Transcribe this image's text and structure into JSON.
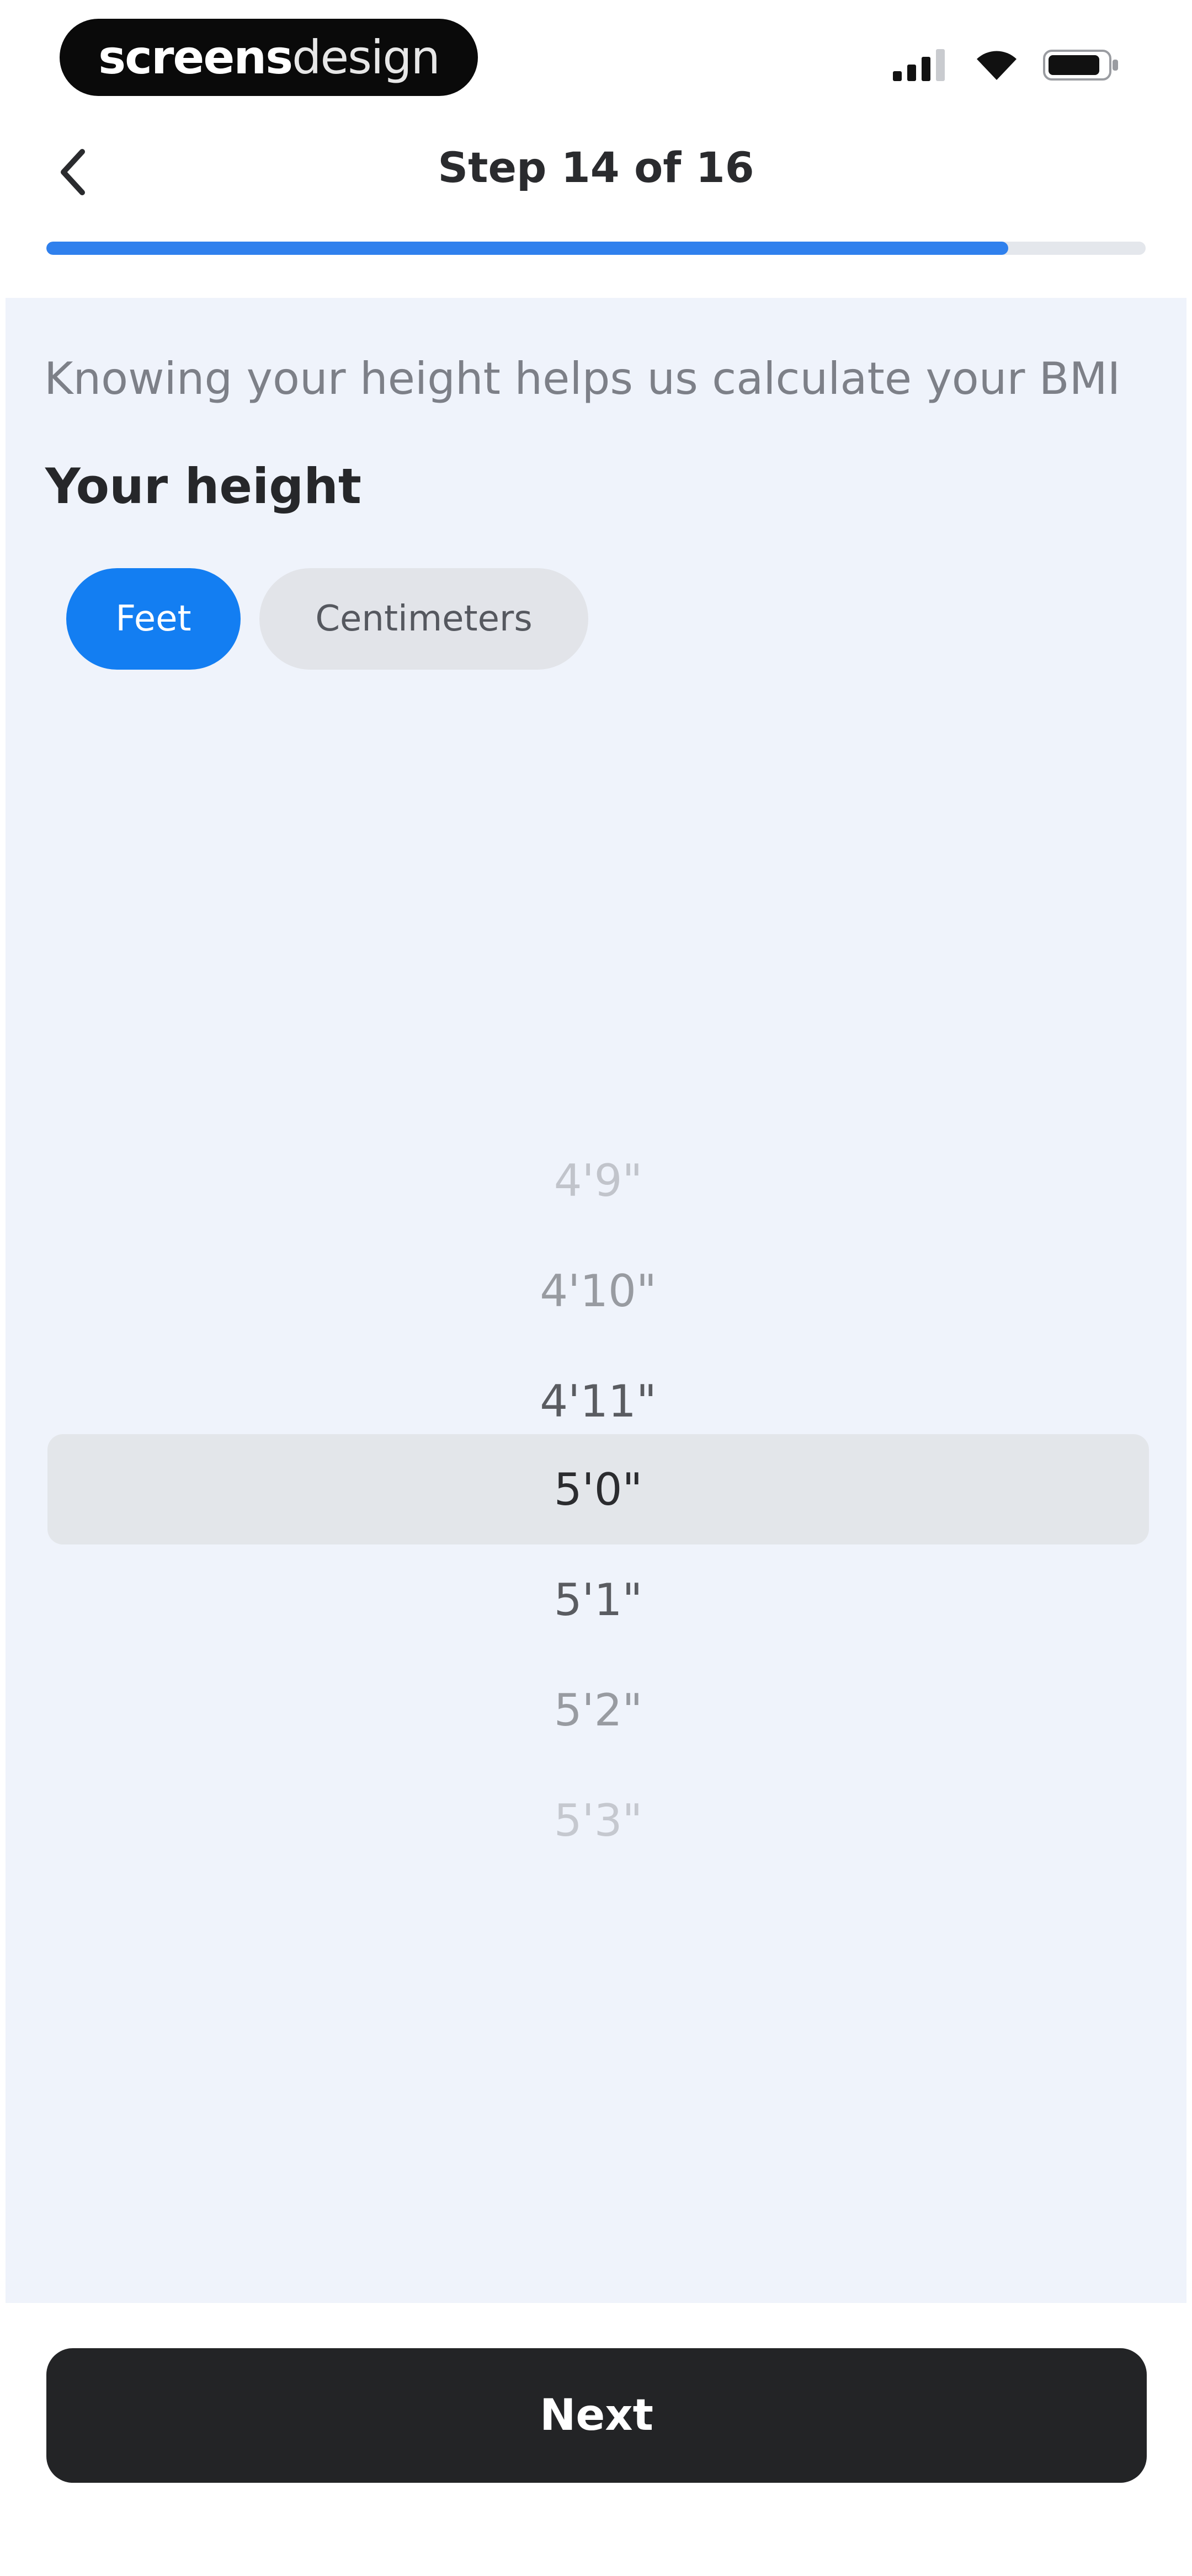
{
  "status_bar": {
    "brand_bold": "screens",
    "brand_light": "design",
    "icons": [
      "signal-icon",
      "wifi-icon",
      "battery-icon"
    ]
  },
  "header": {
    "back_icon": "chevron-left-icon",
    "title": "Step 14 of 16",
    "progress": 0.875,
    "accent_color": "#2f80ed"
  },
  "content": {
    "subtitle": "Knowing your height helps us calculate your BMI",
    "section_title": "Your height",
    "units": [
      {
        "label": "Feet",
        "selected": true
      },
      {
        "label": "Centimeters",
        "selected": false
      }
    ]
  },
  "picker": {
    "items": [
      "4'9\"",
      "4'10\"",
      "4'11\"",
      "5'0\"",
      "5'1\"",
      "5'2\"",
      "5'3\""
    ],
    "selected_index": 3
  },
  "footer": {
    "next_label": "Next"
  }
}
